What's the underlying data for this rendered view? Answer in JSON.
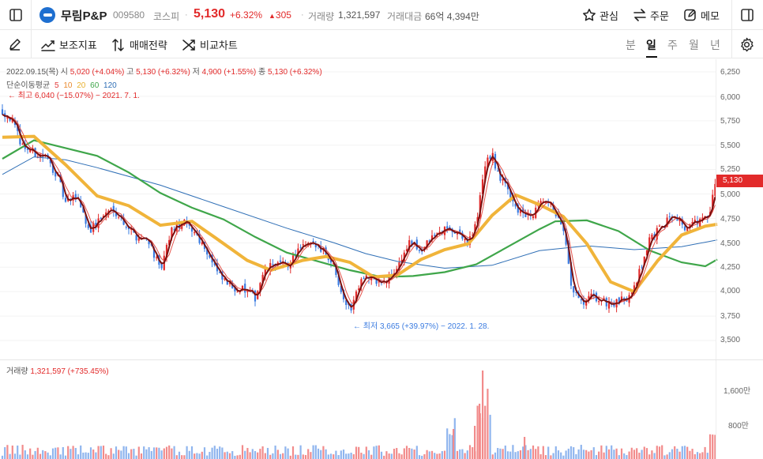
{
  "header": {
    "stock_name": "무림P&P",
    "stock_code": "009580",
    "market": "코스피",
    "price": "5,130",
    "change_pct": "+6.32%",
    "change_arrow": "▲",
    "change_amount": "305",
    "volume_label": "거래량",
    "volume_value": "1,321,597",
    "amount_label": "거래대금",
    "amount_value": "66억 4,394만",
    "favorite_label": "관심",
    "order_label": "주문",
    "memo_label": "메모"
  },
  "toolbar": {
    "indicator_label": "보조지표",
    "strategy_label": "매매전략",
    "compare_label": "비교차트",
    "periods": [
      "분",
      "일",
      "주",
      "월",
      "년"
    ],
    "active_period": "일"
  },
  "chart": {
    "info": {
      "date": "2022.09.15(목)",
      "open_label": "시",
      "open": "5,020 (+4.04%)",
      "high_label": "고",
      "high": "5,130 (+6.32%)",
      "low_label": "저",
      "low": "4,900 (+1.55%)",
      "close_label": "종",
      "close": "5,130 (+6.32%)"
    },
    "ma_title": "단순이동평균",
    "ma": [
      {
        "period": "5",
        "color": "#e23b3b"
      },
      {
        "period": "10",
        "color": "#e98a2e"
      },
      {
        "period": "20",
        "color": "#e8b130"
      },
      {
        "period": "60",
        "color": "#3fa64a"
      },
      {
        "period": "120",
        "color": "#2f6fb6"
      }
    ],
    "max_annotation": "← 최고 6,040 (−15.07%) − 2021. 7. 1.",
    "min_annotation": "← 최저 3,665 (+39.97%) − 2022. 1. 28.",
    "price_ticks": [
      "6,250",
      "6,000",
      "5,750",
      "5,500",
      "5,250",
      "5,000",
      "4,750",
      "4,500",
      "4,250",
      "4,000",
      "3,750",
      "3,500"
    ],
    "current_price_tag": "5,130",
    "volume_info_label": "거래량",
    "volume_info_value": "1,321,597 (+735.45%)",
    "volume_ticks": [
      "1,600만",
      "800만"
    ],
    "colors": {
      "up": "#e22a2a",
      "down": "#3a7be0"
    }
  },
  "chart_data": {
    "type": "candlestick",
    "title": "",
    "ylim": [
      3500,
      6250
    ],
    "anchors": [
      {
        "x": 0,
        "price": 5850
      },
      {
        "x": 10,
        "price": 5780
      },
      {
        "x": 25,
        "price": 5500
      },
      {
        "x": 40,
        "price": 5420
      },
      {
        "x": 55,
        "price": 5380
      },
      {
        "x": 70,
        "price": 5180
      },
      {
        "x": 80,
        "price": 4900
      },
      {
        "x": 95,
        "price": 4980
      },
      {
        "x": 110,
        "price": 4620
      },
      {
        "x": 125,
        "price": 4760
      },
      {
        "x": 140,
        "price": 4860
      },
      {
        "x": 155,
        "price": 4700
      },
      {
        "x": 170,
        "price": 4560
      },
      {
        "x": 185,
        "price": 4540
      },
      {
        "x": 200,
        "price": 4200
      },
      {
        "x": 215,
        "price": 4650
      },
      {
        "x": 230,
        "price": 4700
      },
      {
        "x": 245,
        "price": 4600
      },
      {
        "x": 260,
        "price": 4400
      },
      {
        "x": 275,
        "price": 4150
      },
      {
        "x": 290,
        "price": 4050
      },
      {
        "x": 305,
        "price": 4020
      },
      {
        "x": 320,
        "price": 3940
      },
      {
        "x": 330,
        "price": 4180
      },
      {
        "x": 345,
        "price": 4300
      },
      {
        "x": 360,
        "price": 4250
      },
      {
        "x": 375,
        "price": 4430
      },
      {
        "x": 390,
        "price": 4480
      },
      {
        "x": 405,
        "price": 4450
      },
      {
        "x": 420,
        "price": 4260
      },
      {
        "x": 430,
        "price": 3990
      },
      {
        "x": 440,
        "price": 3800
      },
      {
        "x": 455,
        "price": 4170
      },
      {
        "x": 470,
        "price": 4120
      },
      {
        "x": 485,
        "price": 4080
      },
      {
        "x": 500,
        "price": 4250
      },
      {
        "x": 515,
        "price": 4500
      },
      {
        "x": 530,
        "price": 4420
      },
      {
        "x": 545,
        "price": 4560
      },
      {
        "x": 560,
        "price": 4640
      },
      {
        "x": 575,
        "price": 4580
      },
      {
        "x": 590,
        "price": 4540
      },
      {
        "x": 600,
        "price": 4700
      },
      {
        "x": 612,
        "price": 5350
      },
      {
        "x": 620,
        "price": 5400
      },
      {
        "x": 630,
        "price": 5150
      },
      {
        "x": 640,
        "price": 5050
      },
      {
        "x": 655,
        "price": 4800
      },
      {
        "x": 670,
        "price": 4760
      },
      {
        "x": 685,
        "price": 4930
      },
      {
        "x": 700,
        "price": 4820
      },
      {
        "x": 712,
        "price": 4550
      },
      {
        "x": 720,
        "price": 4050
      },
      {
        "x": 735,
        "price": 3850
      },
      {
        "x": 745,
        "price": 3950
      },
      {
        "x": 760,
        "price": 3900
      },
      {
        "x": 775,
        "price": 3870
      },
      {
        "x": 790,
        "price": 3930
      },
      {
        "x": 805,
        "price": 4160
      },
      {
        "x": 820,
        "price": 4550
      },
      {
        "x": 835,
        "price": 4650
      },
      {
        "x": 850,
        "price": 4820
      },
      {
        "x": 865,
        "price": 4650
      },
      {
        "x": 880,
        "price": 4720
      },
      {
        "x": 895,
        "price": 4760
      },
      {
        "x": 903,
        "price": 5130
      }
    ],
    "ma_data": {
      "ma20": [
        [
          0,
          5580
        ],
        [
          40,
          5590
        ],
        [
          80,
          5300
        ],
        [
          120,
          4980
        ],
        [
          160,
          4880
        ],
        [
          200,
          4680
        ],
        [
          240,
          4720
        ],
        [
          270,
          4550
        ],
        [
          310,
          4320
        ],
        [
          340,
          4220
        ],
        [
          380,
          4320
        ],
        [
          410,
          4360
        ],
        [
          440,
          4300
        ],
        [
          470,
          4150
        ],
        [
          500,
          4170
        ],
        [
          530,
          4330
        ],
        [
          560,
          4430
        ],
        [
          590,
          4490
        ],
        [
          620,
          4780
        ],
        [
          650,
          4990
        ],
        [
          680,
          4890
        ],
        [
          710,
          4770
        ],
        [
          740,
          4490
        ],
        [
          770,
          4100
        ],
        [
          800,
          4000
        ],
        [
          830,
          4320
        ],
        [
          860,
          4580
        ],
        [
          890,
          4670
        ],
        [
          905,
          4690
        ]
      ],
      "ma60": [
        [
          0,
          5360
        ],
        [
          40,
          5550
        ],
        [
          80,
          5470
        ],
        [
          120,
          5390
        ],
        [
          160,
          5220
        ],
        [
          200,
          5010
        ],
        [
          240,
          4860
        ],
        [
          280,
          4740
        ],
        [
          320,
          4560
        ],
        [
          360,
          4400
        ],
        [
          400,
          4310
        ],
        [
          440,
          4220
        ],
        [
          480,
          4150
        ],
        [
          520,
          4160
        ],
        [
          560,
          4200
        ],
        [
          600,
          4280
        ],
        [
          640,
          4460
        ],
        [
          680,
          4640
        ],
        [
          700,
          4720
        ],
        [
          740,
          4730
        ],
        [
          780,
          4620
        ],
        [
          820,
          4420
        ],
        [
          860,
          4300
        ],
        [
          890,
          4260
        ],
        [
          905,
          4330
        ]
      ],
      "ma120": [
        [
          0,
          5200
        ],
        [
          40,
          5380
        ],
        [
          80,
          5350
        ],
        [
          120,
          5270
        ],
        [
          200,
          5090
        ],
        [
          280,
          4870
        ],
        [
          360,
          4650
        ],
        [
          420,
          4500
        ],
        [
          460,
          4390
        ],
        [
          500,
          4310
        ],
        [
          560,
          4240
        ],
        [
          620,
          4270
        ],
        [
          680,
          4420
        ],
        [
          740,
          4470
        ],
        [
          800,
          4430
        ],
        [
          860,
          4460
        ],
        [
          905,
          4530
        ]
      ]
    }
  }
}
